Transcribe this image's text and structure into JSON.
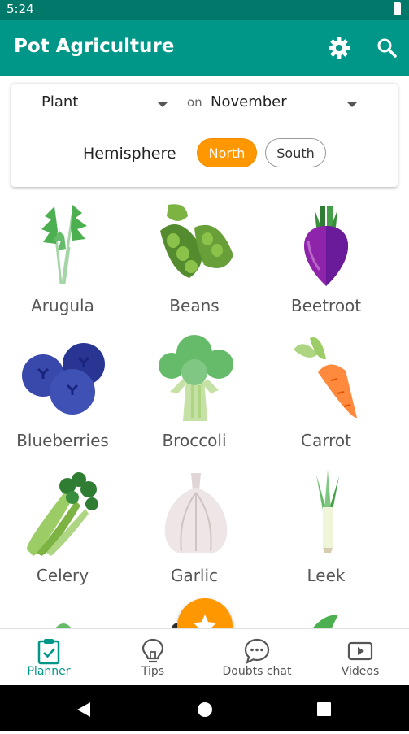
{
  "status": {
    "time": "5:24"
  },
  "app": {
    "title": "Pot Agriculture"
  },
  "filter": {
    "action": "Plant",
    "on_label": "on",
    "month": "November",
    "hemisphere_label": "Hemisphere",
    "north": "North",
    "south": "South",
    "selected": "North"
  },
  "crops": [
    {
      "name": "Arugula",
      "icon": "arugula-icon"
    },
    {
      "name": "Beans",
      "icon": "beans-icon"
    },
    {
      "name": "Beetroot",
      "icon": "beetroot-icon"
    },
    {
      "name": "Blueberries",
      "icon": "blueberries-icon"
    },
    {
      "name": "Broccoli",
      "icon": "broccoli-icon"
    },
    {
      "name": "Carrot",
      "icon": "carrot-icon"
    },
    {
      "name": "Celery",
      "icon": "celery-icon"
    },
    {
      "name": "Garlic",
      "icon": "garlic-icon"
    },
    {
      "name": "Leek",
      "icon": "leek-icon"
    }
  ],
  "nav": [
    {
      "label": "Planner",
      "icon": "clipboard-check-icon",
      "active": true
    },
    {
      "label": "Tips",
      "icon": "lightbulb-icon",
      "active": false
    },
    {
      "label": "Doubts chat",
      "icon": "chat-bubble-icon",
      "active": false
    },
    {
      "label": "Videos",
      "icon": "play-video-icon",
      "active": false
    }
  ],
  "colors": {
    "primary": "#009688",
    "primary_dark": "#00796b",
    "accent": "#ff9800"
  }
}
